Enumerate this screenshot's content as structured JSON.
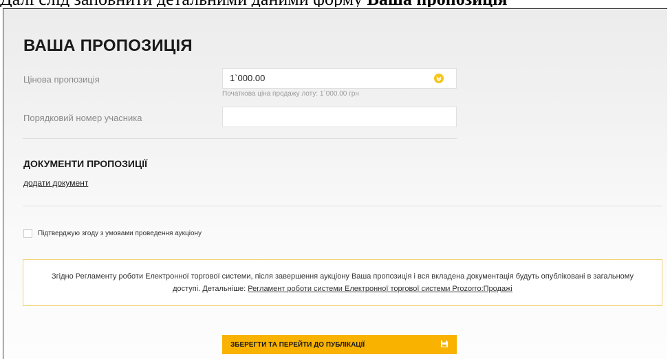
{
  "caption": {
    "prefix": "Далі слід заповнити детальними даними форму",
    "bold": "Ваша пропозиція"
  },
  "form": {
    "title": "ВАША ПРОПОЗИЦІЯ",
    "price_label": "Цінова пропозиція",
    "price_value": "1`000.00",
    "price_hint": "Початкова ціна продажу лоту: 1`000.00 грн",
    "participant_label": "Порядковий номер учасника",
    "participant_value": ""
  },
  "documents": {
    "title": "ДОКУМЕНТИ ПРОПОЗИЦІЇ",
    "add_link": "додати документ"
  },
  "agreement": {
    "label": "Підтверджую згоду з умовами проведення аукціону",
    "checked": false
  },
  "notice": {
    "text": "Згідно Регламенту роботи Електронної торгової системи, після завершення аукціону Ваша пропозиція і вся вкладена документація будуть опубліковані в загальному доступі. Детальніше: ",
    "link": "Регламент роботи системи Електронної торгової системи Prozorro:Продажі"
  },
  "actions": {
    "save_label": "ЗБЕРЕГТИ ТА ПЕРЕЙТИ ДО ПУБЛІКАЦІЇ"
  },
  "colors": {
    "accent": "#f9b200",
    "notice_border": "#f2d06b"
  },
  "icons": {
    "valid": "check-circle-icon",
    "save": "floppy-disk-icon"
  }
}
